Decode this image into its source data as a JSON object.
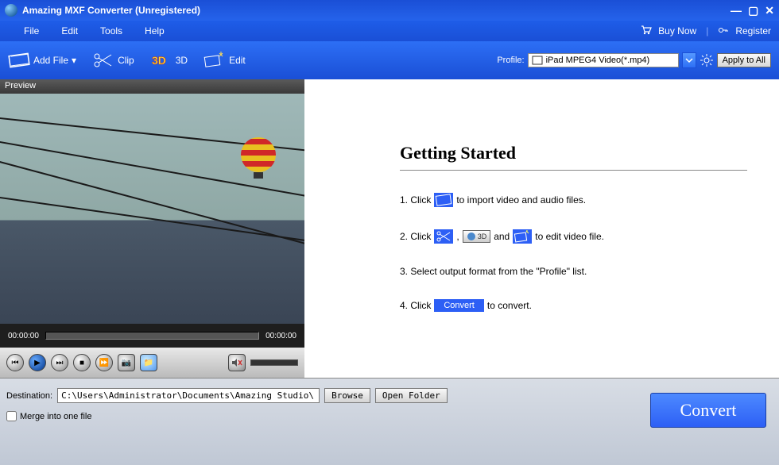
{
  "window": {
    "title": "Amazing MXF Converter (Unregistered)"
  },
  "menu": {
    "file": "File",
    "edit": "Edit",
    "tools": "Tools",
    "help": "Help",
    "buy": "Buy Now",
    "register": "Register"
  },
  "toolbar": {
    "add_file": "Add File",
    "clip": "Clip",
    "three_d": "3D",
    "edit": "Edit",
    "profile_label": "Profile:",
    "profile_value": "iPad MPEG4 Video(*.mp4)",
    "apply_all": "Apply to All"
  },
  "preview": {
    "header": "Preview",
    "time_start": "00:00:00",
    "time_end": "00:00:00"
  },
  "getting_started": {
    "title": "Getting Started",
    "step1_a": "1. Click",
    "step1_b": "to import video and audio files.",
    "step2_a": "2. Click",
    "step2_b": ",",
    "step2_3d": "3D",
    "step2_c": "and",
    "step2_d": "to edit video file.",
    "step3": "3. Select output format from the \"Profile\" list.",
    "step4_a": "4. Click",
    "step4_btn": "Convert",
    "step4_b": "to convert."
  },
  "bottom": {
    "dest_label": "Destination:",
    "dest_value": "C:\\Users\\Administrator\\Documents\\Amazing Studio\\",
    "browse": "Browse",
    "open_folder": "Open Folder",
    "merge": "Merge into one file",
    "convert": "Convert"
  }
}
